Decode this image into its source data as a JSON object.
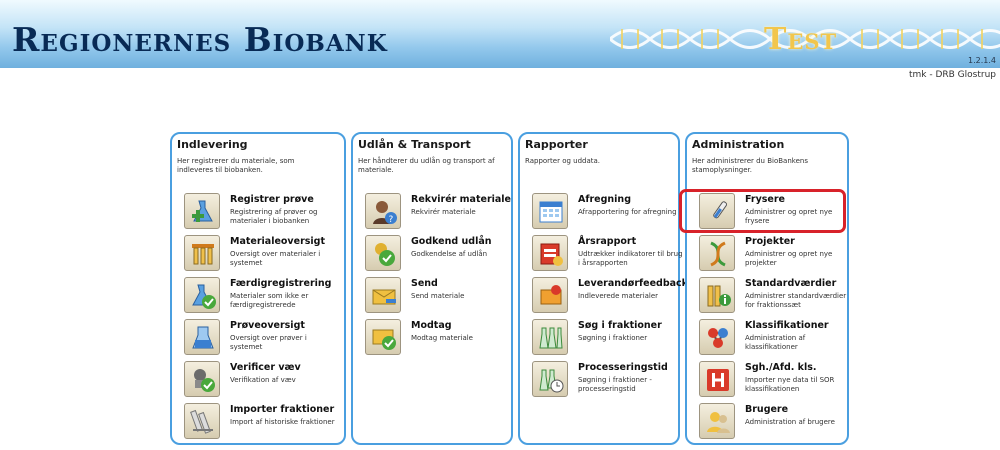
{
  "header": {
    "title": "Regionernes Biobank",
    "environment_label": "Test",
    "version": "1.2.1.4",
    "user_info": "tmk - DRB Glostrup"
  },
  "panels": [
    {
      "title": "Indlevering",
      "description": "Her registrerer du materiale, som indleveres til biobanken.",
      "items": [
        {
          "title": "Registrer prøve",
          "description": "Registrering af prøver og materialer i biobanken",
          "icon": "flask-plus-icon"
        },
        {
          "title": "Materialeoversigt",
          "description": "Oversigt over materialer i systemet",
          "icon": "test-tubes-icon"
        },
        {
          "title": "Færdigregistrering",
          "description": "Materialer som ikke er færdigregistrerede",
          "icon": "flask-check-icon"
        },
        {
          "title": "Prøveoversigt",
          "description": "Oversigt over prøver i systemet",
          "icon": "beaker-icon"
        },
        {
          "title": "Verificer væv",
          "description": "Verifikation af væv",
          "icon": "tissue-check-icon"
        },
        {
          "title": "Importer fraktioner",
          "description": "Import af historiske fraktioner",
          "icon": "import-tubes-icon"
        }
      ]
    },
    {
      "title": "Udlån & Transport",
      "description": "Her håndterer du udlån og transport af materiale.",
      "items": [
        {
          "title": "Rekvirér materiale",
          "description": "Rekvirér materiale",
          "icon": "person-request-icon"
        },
        {
          "title": "Godkend udlån",
          "description": "Godkendelse af udlån",
          "icon": "approve-check-icon"
        },
        {
          "title": "Send",
          "description": "Send materiale",
          "icon": "send-box-icon"
        },
        {
          "title": "Modtag",
          "description": "Modtag materiale",
          "icon": "receive-box-icon"
        }
      ]
    },
    {
      "title": "Rapporter",
      "description": "Rapporter og uddata.",
      "items": [
        {
          "title": "Afregning",
          "description": "Afrapportering for afregning",
          "icon": "calendar-icon"
        },
        {
          "title": "Årsrapport",
          "description": "Udtrækker indikatorer til brug i årsrapporten",
          "icon": "annual-report-icon"
        },
        {
          "title": "Leverandørfeedback",
          "description": "Indleverede materialer",
          "icon": "feedback-icon"
        },
        {
          "title": "Søg i fraktioner",
          "description": "Søgning i fraktioner",
          "icon": "bottles-icon"
        },
        {
          "title": "Processeringstid",
          "description": "Søgning i fraktioner - processeringstid",
          "icon": "bottles-clock-icon"
        }
      ]
    },
    {
      "title": "Administration",
      "description": "Her administrerer du BioBankens stamoplysninger.",
      "items": [
        {
          "title": "Frysere",
          "description": "Administrer og opret nye frysere",
          "icon": "thermometer-icon"
        },
        {
          "title": "Projekter",
          "description": "Administrer og opret nye projekter",
          "icon": "dna-icon"
        },
        {
          "title": "Standardværdier",
          "description": "Administrer standardværdier for fraktionssæt",
          "icon": "tubes-info-icon"
        },
        {
          "title": "Klassifikationer",
          "description": "Administration af klassifikationer",
          "icon": "molecule-icon"
        },
        {
          "title": "Sgh./Afd. kls.",
          "description": "Importer nye data til SOR klassifikationen",
          "icon": "hospital-icon"
        },
        {
          "title": "Brugere",
          "description": "Administration af brugere",
          "icon": "users-icon"
        }
      ]
    }
  ],
  "colors": {
    "panel_border": "#4a9fe0",
    "highlight": "#d8222a",
    "title_text": "#082a55",
    "test_label": "#f2c64c"
  }
}
